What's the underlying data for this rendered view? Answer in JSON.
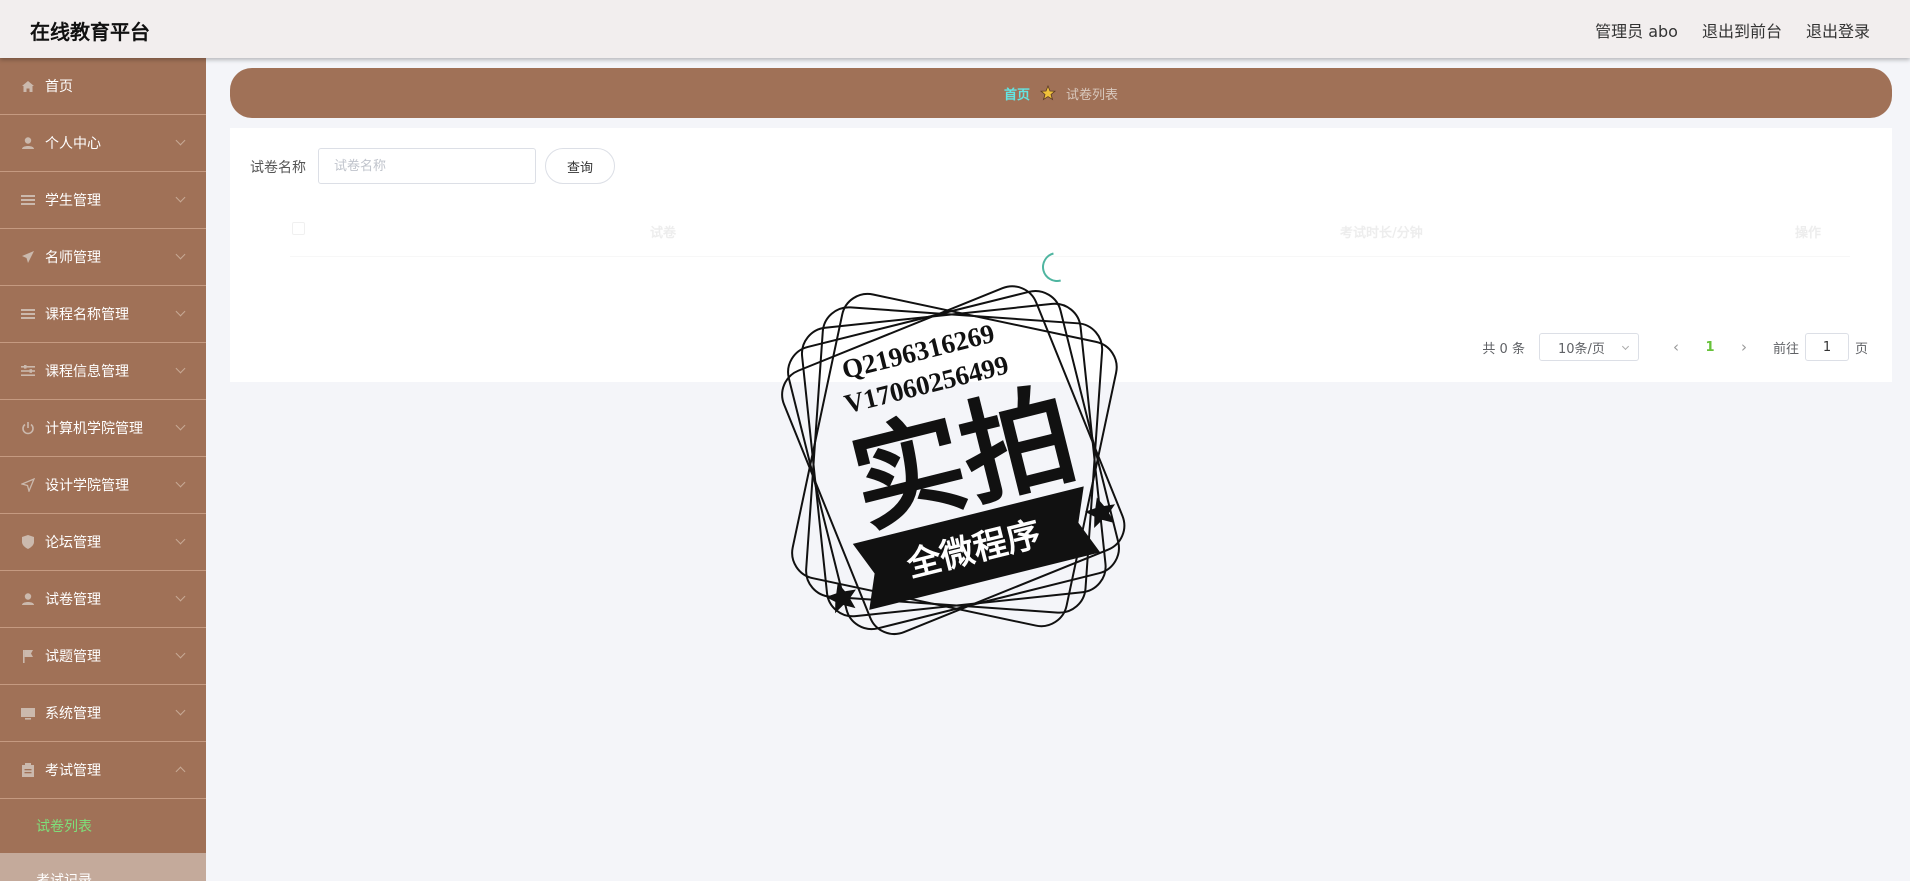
{
  "header": {
    "brand": "在线教育平台",
    "user": "管理员 abo",
    "to_front": "退出到前台",
    "logout": "退出登录"
  },
  "sidebar": {
    "items": [
      {
        "label": "首页",
        "icon": "home-icon"
      },
      {
        "label": "个人中心",
        "icon": "person-icon"
      },
      {
        "label": "学生管理",
        "icon": "list-icon"
      },
      {
        "label": "名师管理",
        "icon": "send-icon"
      },
      {
        "label": "课程名称管理",
        "icon": "list-icon"
      },
      {
        "label": "课程信息管理",
        "icon": "sliders-icon"
      },
      {
        "label": "计算机学院管理",
        "icon": "power-icon"
      },
      {
        "label": "设计学院管理",
        "icon": "navigation-icon"
      },
      {
        "label": "论坛管理",
        "icon": "shield-icon"
      },
      {
        "label": "试卷管理",
        "icon": "person-icon"
      },
      {
        "label": "试题管理",
        "icon": "flag-icon"
      },
      {
        "label": "系统管理",
        "icon": "monitor-icon"
      },
      {
        "label": "考试管理",
        "icon": "clipboard-icon"
      }
    ],
    "sub_items": [
      {
        "label": "试卷列表",
        "active": true
      },
      {
        "label": "考试记录",
        "active": false
      }
    ]
  },
  "breadcrumb": {
    "home": "首页",
    "current": "试卷列表"
  },
  "search": {
    "label": "试卷名称",
    "placeholder": "试卷名称",
    "button": "查询"
  },
  "table": {
    "columns": [
      "试卷",
      "考试时长/分钟",
      "操作"
    ]
  },
  "pagination": {
    "total": "共 0 条",
    "page_size": "10条/页",
    "current_page": "1",
    "goto_prefix": "前往",
    "goto_value": "1",
    "goto_suffix": "页"
  },
  "watermark": {
    "line1": "Q2196316269",
    "line2": "V17060256499",
    "main": "实拍",
    "banner": "全微程序"
  }
}
